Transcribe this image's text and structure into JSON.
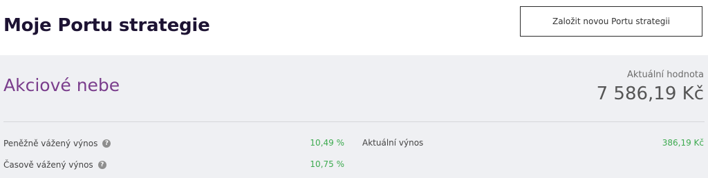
{
  "header": {
    "title": "Moje Portu strategie",
    "new_strategy_label": "Založit novou Portu strategii"
  },
  "strategy": {
    "name": "Akciové nebe",
    "current_value_label": "Aktuální hodnota",
    "current_value": "7 586,19 Kč",
    "metrics": {
      "money_weighted_label": "Peněžně vážený výnos",
      "money_weighted_value": "10,49 %",
      "time_weighted_label": "Časově vážený výnos",
      "time_weighted_value": "10,75 %",
      "current_return_label": "Aktuální výnos",
      "current_return_value": "386,19 Kč"
    }
  },
  "colors": {
    "title": "#1d1333",
    "strategy_name": "#7a3d8c",
    "positive_value": "#3daa4f",
    "card_background": "#eff0f3"
  },
  "icons": {
    "help": "help-question-icon"
  }
}
